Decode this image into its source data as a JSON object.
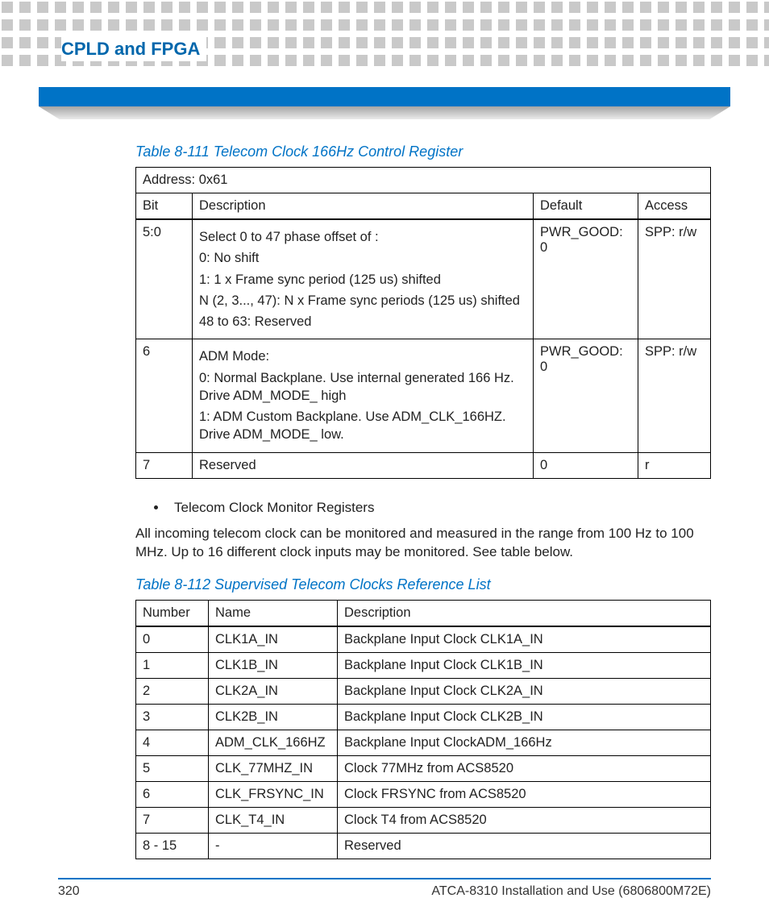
{
  "header": {
    "section_title": "CPLD and FPGA"
  },
  "table1": {
    "caption": "Table 8-111 Telecom Clock 166Hz Control Register",
    "address_label": "Address: 0x61",
    "columns": {
      "bit": "Bit",
      "desc": "Description",
      "def": "Default",
      "acc": "Access"
    },
    "rows": [
      {
        "bit": "5:0",
        "desc": [
          "Select 0 to 47 phase offset of :",
          "0: No shift",
          "1: 1 x Frame sync period (125 us) shifted",
          "N (2, 3..., 47): N x Frame sync periods (125 us) shifted",
          "48 to 63: Reserved"
        ],
        "def": "PWR_GOOD: 0",
        "acc": "SPP: r/w"
      },
      {
        "bit": "6",
        "desc": [
          "ADM Mode:",
          "0: Normal Backplane. Use internal generated 166 Hz. Drive ADM_MODE_ high",
          "1: ADM Custom Backplane. Use ADM_CLK_166HZ. Drive ADM_MODE_ low."
        ],
        "def": "PWR_GOOD: 0",
        "acc": "SPP: r/w"
      },
      {
        "bit": "7",
        "desc": [
          "Reserved"
        ],
        "def": "0",
        "acc": "r"
      }
    ]
  },
  "bullets": {
    "item1": "Telecom Clock Monitor Registers"
  },
  "paragraph1": "All incoming telecom clock can be monitored and measured in the range from 100 Hz to 100 MHz. Up to 16 different clock inputs may be monitored. See table below.",
  "table2": {
    "caption": "Table 8-112 Supervised Telecom Clocks Reference List",
    "columns": {
      "num": "Number",
      "name": "Name",
      "desc": "Description"
    },
    "rows": [
      {
        "num": "0",
        "name": "CLK1A_IN",
        "desc": "Backplane Input Clock CLK1A_IN"
      },
      {
        "num": "1",
        "name": "CLK1B_IN",
        "desc": "Backplane Input Clock CLK1B_IN"
      },
      {
        "num": "2",
        "name": "CLK2A_IN",
        "desc": "Backplane Input Clock CLK2A_IN"
      },
      {
        "num": "3",
        "name": "CLK2B_IN",
        "desc": "Backplane Input Clock CLK2B_IN"
      },
      {
        "num": "4",
        "name": "ADM_CLK_166HZ",
        "desc": "Backplane Input ClockADM_166Hz"
      },
      {
        "num": "5",
        "name": "CLK_77MHZ_IN",
        "desc": "Clock 77MHz from ACS8520"
      },
      {
        "num": "6",
        "name": "CLK_FRSYNC_IN",
        "desc": "Clock FRSYNC from ACS8520"
      },
      {
        "num": "7",
        "name": "CLK_T4_IN",
        "desc": "Clock T4  from ACS8520"
      },
      {
        "num": "8 - 15",
        "name": "-",
        "desc": "Reserved"
      }
    ]
  },
  "footer": {
    "page": "320",
    "doc": "ATCA-8310 Installation and Use (6806800M72E)"
  }
}
